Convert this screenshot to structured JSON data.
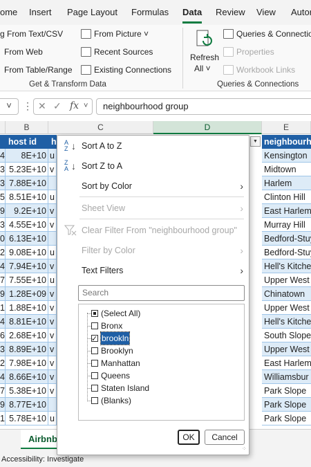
{
  "ribbon_tabs": [
    "ome",
    "Insert",
    "Page Layout",
    "Formulas",
    "Data",
    "Review",
    "View",
    "Autor"
  ],
  "active_tab": "Data",
  "ribbon": {
    "get_transform": {
      "items": [
        "g From Text/CSV",
        "From Web",
        "From Table/Range"
      ],
      "right_items": [
        "From Picture ˅",
        "Recent Sources",
        "Existing Connections"
      ],
      "label": "Get & Transform Data"
    },
    "queries": {
      "refresh_label_1": "Refresh",
      "refresh_label_2": "All ˅",
      "items": [
        "Queries & Connectio",
        "Properties",
        "Workbook Links"
      ],
      "label": "Queries & Connections"
    }
  },
  "formula_bar": {
    "namebox": "˅",
    "more": "⋮",
    "fx": "fx",
    "value": "neighbourhood group"
  },
  "columns": [
    "B",
    "C",
    "D",
    "E"
  ],
  "header_row": {
    "a": "",
    "b": "host id",
    "c": "h",
    "e": "neighbourh"
  },
  "rows": [
    {
      "a": "4",
      "b": "8E+10",
      "c": "u",
      "e": "Kensington"
    },
    {
      "a": "3",
      "b": "5.23E+10",
      "c": "v",
      "e": "Midtown"
    },
    {
      "a": "3",
      "b": "7.88E+10",
      "c": "",
      "e": "Harlem"
    },
    {
      "a": "5",
      "b": "8.51E+10",
      "c": "u",
      "e": "Clinton Hill"
    },
    {
      "a": "9",
      "b": "9.2E+10",
      "c": "v",
      "e": "East Harlem"
    },
    {
      "a": "3",
      "b": "4.55E+10",
      "c": "v",
      "e": "Murray Hill"
    },
    {
      "a": "0",
      "b": "6.13E+10",
      "c": "",
      "e": "Bedford-Stuy"
    },
    {
      "a": "2",
      "b": "9.08E+10",
      "c": "u",
      "e": "Bedford-Stuy"
    },
    {
      "a": "4",
      "b": "7.94E+10",
      "c": "v",
      "e": "Hell's Kitche"
    },
    {
      "a": "7",
      "b": "7.55E+10",
      "c": "u",
      "e": "Upper West"
    },
    {
      "a": "9",
      "b": "1.28E+09",
      "c": "v",
      "e": "Chinatown"
    },
    {
      "a": "1",
      "b": "1.88E+10",
      "c": "v",
      "e": "Upper West"
    },
    {
      "a": "4",
      "b": "8.81E+10",
      "c": "v",
      "e": "Hell's Kitche"
    },
    {
      "a": "6",
      "b": "2.68E+10",
      "c": "v",
      "e": "South Slope"
    },
    {
      "a": "3",
      "b": "8.89E+10",
      "c": "v",
      "e": "Upper West"
    },
    {
      "a": "2",
      "b": "7.98E+10",
      "c": "v",
      "e": "East Harlem"
    },
    {
      "a": "4",
      "b": "8.66E+10",
      "c": "v",
      "e": "Williamsbur"
    },
    {
      "a": "7",
      "b": "5.38E+10",
      "c": "v",
      "e": "Park Slope"
    },
    {
      "a": "9",
      "b": "8.77E+10",
      "c": "",
      "e": "Park Slope"
    },
    {
      "a": "1",
      "b": "5.78E+10",
      "c": "u",
      "e": "Park Slope"
    }
  ],
  "filter_menu": {
    "sort_az": "Sort A to Z",
    "sort_za": "Sort Z to A",
    "sort_by_color": "Sort by Color",
    "sheet_view": "Sheet View",
    "clear_filter": "Clear Filter From \"neighbourhood group\"",
    "filter_by_color": "Filter by Color",
    "text_filters": "Text Filters",
    "search_placeholder": "Search",
    "values": [
      {
        "label": "(Select All)",
        "state": "partial"
      },
      {
        "label": "Bronx",
        "state": "unchecked"
      },
      {
        "label": "brookln",
        "state": "checked"
      },
      {
        "label": "Brooklyn",
        "state": "unchecked"
      },
      {
        "label": "Manhattan",
        "state": "unchecked"
      },
      {
        "label": "Queens",
        "state": "unchecked"
      },
      {
        "label": "Staten Island",
        "state": "unchecked"
      },
      {
        "label": "(Blanks)",
        "state": "unchecked"
      }
    ],
    "ok": "OK",
    "cancel": "Cancel"
  },
  "sheet_tab": "Airbnb",
  "status": "Accessibility: Investigate",
  "colors": {
    "header_blue": "#1f5fa5",
    "band_blue": "#ddebf7",
    "excel_green": "#107c41"
  }
}
